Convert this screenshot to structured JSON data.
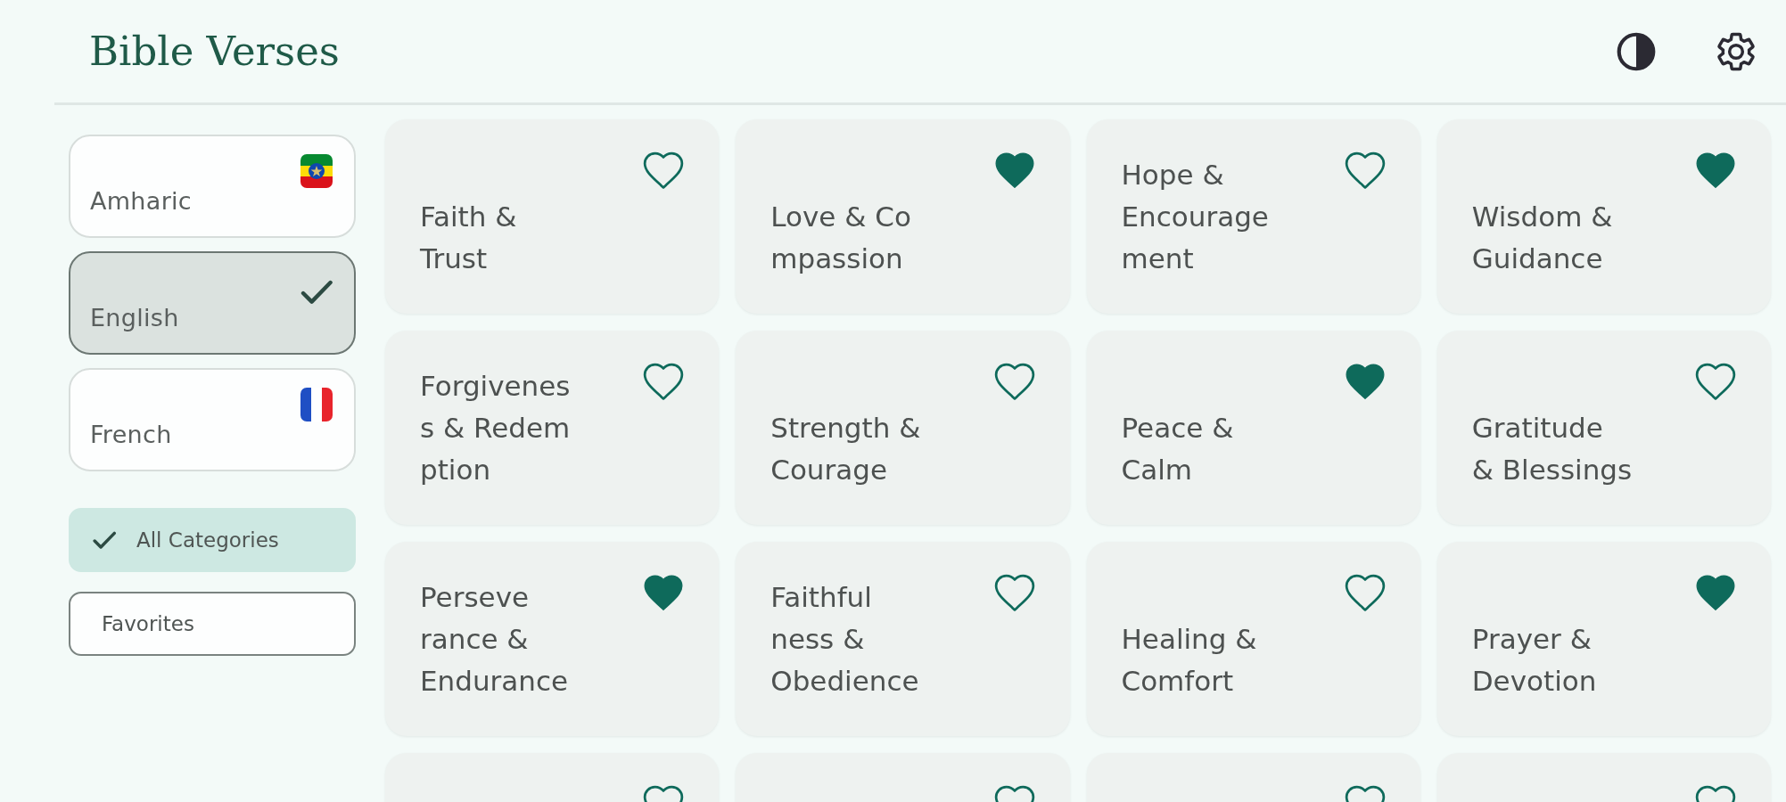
{
  "header": {
    "title": "Bible Verses"
  },
  "languages": [
    {
      "name": "Amharic",
      "selected": false
    },
    {
      "name": "English",
      "selected": true
    },
    {
      "name": "French",
      "selected": false
    }
  ],
  "filters": [
    {
      "label": "All Categories",
      "selected": true
    },
    {
      "label": "Favorites",
      "selected": false
    }
  ],
  "categories": [
    {
      "title": "Faith &\nTrust",
      "favorite": false
    },
    {
      "title": "Love & Co\nmpassion",
      "favorite": true
    },
    {
      "title": "Hope &\nEncourage\nment",
      "favorite": false
    },
    {
      "title": "Wisdom &\nGuidance",
      "favorite": true
    },
    {
      "title": "Forgivenes\ns & Redem\nption",
      "favorite": false
    },
    {
      "title": "Strength &\nCourage",
      "favorite": false
    },
    {
      "title": "Peace &\nCalm",
      "favorite": true
    },
    {
      "title": "Gratitude\n& Blessings",
      "favorite": false
    },
    {
      "title": "Perseve\nrance &\nEndurance",
      "favorite": true
    },
    {
      "title": "Faithful\nness &\nObedience",
      "favorite": false
    },
    {
      "title": "Healing &\nComfort",
      "favorite": false
    },
    {
      "title": "Prayer &\nDevotion",
      "favorite": true
    },
    {
      "favorite": false
    },
    {
      "favorite": false
    },
    {
      "favorite": false
    },
    {
      "favorite": false
    }
  ]
}
